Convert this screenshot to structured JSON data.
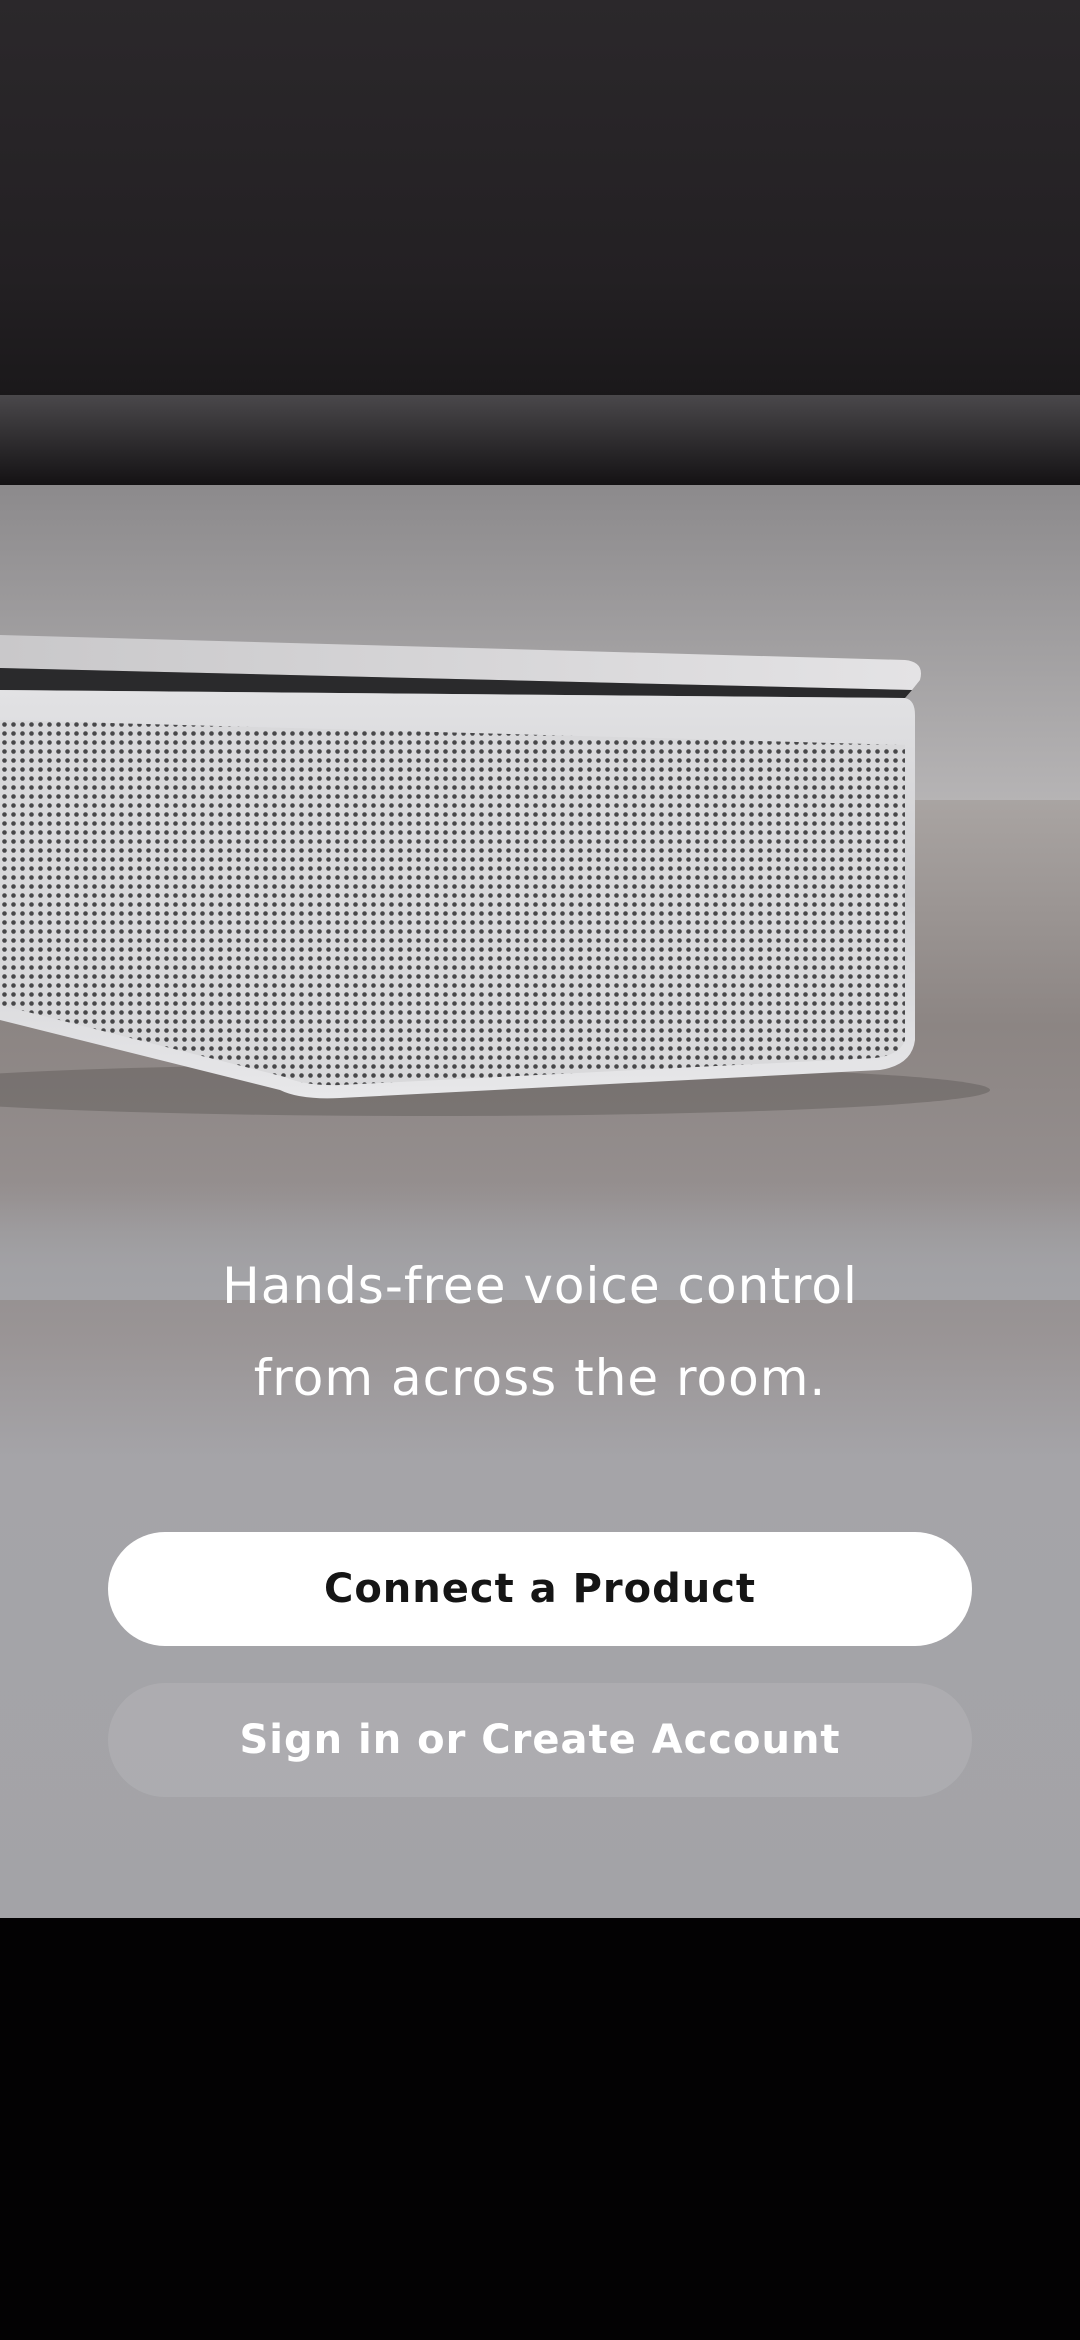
{
  "hero": {
    "image_description_icon": "soundbar-photo",
    "colors": {
      "tv_dark": "#232024",
      "speaker_silver": "#d9d9db",
      "grille_dark": "#3a3a3c",
      "surface_wood": "#8f8886",
      "panel_gray": "#a3a3a7"
    }
  },
  "tagline": {
    "line1": "Hands-free voice control",
    "line2": "from across the room."
  },
  "buttons": {
    "connect_label": "Connect a Product",
    "signin_label": "Sign in or Create Account"
  },
  "colors": {
    "primary_button_bg": "#ffffff",
    "primary_button_text": "#151515",
    "bottom_bar": "#030203"
  }
}
